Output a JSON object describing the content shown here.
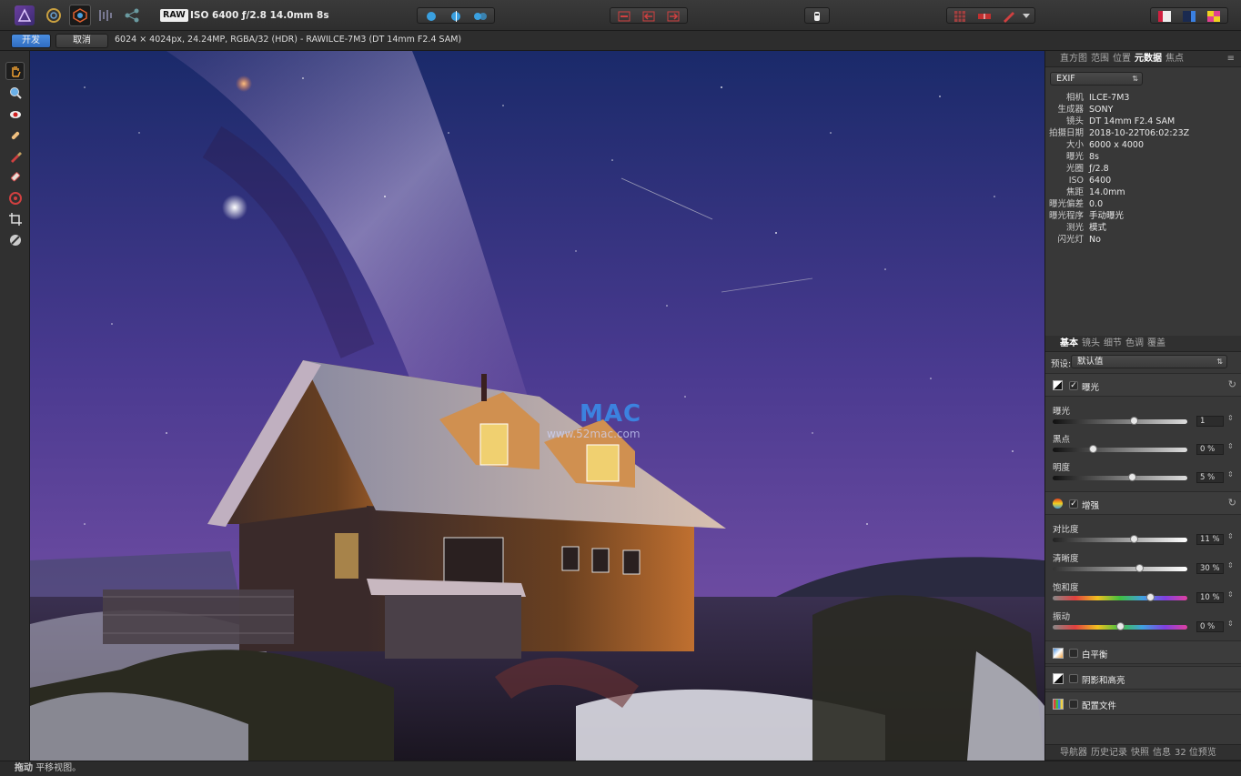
{
  "toolbar": {
    "raw_badge": "RAW",
    "exposure_info": "ISO 6400 ƒ/2.8 14.0mm 8s"
  },
  "context": {
    "develop_label": "开发",
    "cancel_label": "取消",
    "image_info": "6024 × 4024px, 24.24MP, RGBA/32 (HDR) - RAW",
    "camera_info": "ILCE-7M3 (DT 14mm F2.4 SAM)"
  },
  "top_panel": {
    "tabs": [
      "直方图",
      "范围",
      "位置",
      "元数据",
      "焦点"
    ],
    "active_tab": 3,
    "metadata_type": "EXIF",
    "fields": [
      {
        "k": "相机",
        "v": "ILCE-7M3"
      },
      {
        "k": "生成器",
        "v": "SONY"
      },
      {
        "k": "镜头",
        "v": "DT 14mm F2.4 SAM"
      },
      {
        "k": "拍摄日期",
        "v": "2018-10-22T06:02:23Z"
      },
      {
        "k": "大小",
        "v": "6000 x 4000"
      },
      {
        "k": "曝光",
        "v": "8s"
      },
      {
        "k": "光圈",
        "v": "ƒ/2.8"
      },
      {
        "k": "ISO",
        "v": "6400"
      },
      {
        "k": "焦距",
        "v": "14.0mm"
      },
      {
        "k": "曝光偏差",
        "v": "0.0"
      },
      {
        "k": "曝光程序",
        "v": "手动曝光"
      },
      {
        "k": "测光",
        "v": "模式"
      },
      {
        "k": "闪光灯",
        "v": "No"
      }
    ]
  },
  "develop_panel": {
    "tabs": [
      "基本",
      "镜头",
      "细节",
      "色调",
      "覆盖"
    ],
    "active_tab": 0,
    "preset_label": "预设:",
    "preset_value": "默认值",
    "exposure_section": {
      "title": "曝光",
      "sliders": [
        {
          "label": "曝光",
          "value": "1",
          "pos": 0.6
        },
        {
          "label": "黑点",
          "value": "0 %",
          "pos": 0.3
        },
        {
          "label": "明度",
          "value": "5 %",
          "pos": 0.59
        }
      ]
    },
    "enhance_section": {
      "title": "增强",
      "sliders": [
        {
          "label": "对比度",
          "value": "11 %",
          "pos": 0.6
        },
        {
          "label": "清晰度",
          "value": "30 %",
          "pos": 0.64
        },
        {
          "label": "饱和度",
          "value": "10 %",
          "pos": 0.72
        },
        {
          "label": "振动",
          "value": "0 %",
          "pos": 0.5
        }
      ]
    },
    "white_balance": "白平衡",
    "shadows_highlights": "阴影和高亮",
    "profile": "配置文件"
  },
  "bottom_tabs": [
    "导航器",
    "历史记录",
    "快照",
    "信息",
    "32 位预览"
  ],
  "status": {
    "bold": "拖动",
    "text": "平移视图。"
  },
  "watermark": {
    "brand": "MAC",
    "url": "www.52mac.com"
  }
}
